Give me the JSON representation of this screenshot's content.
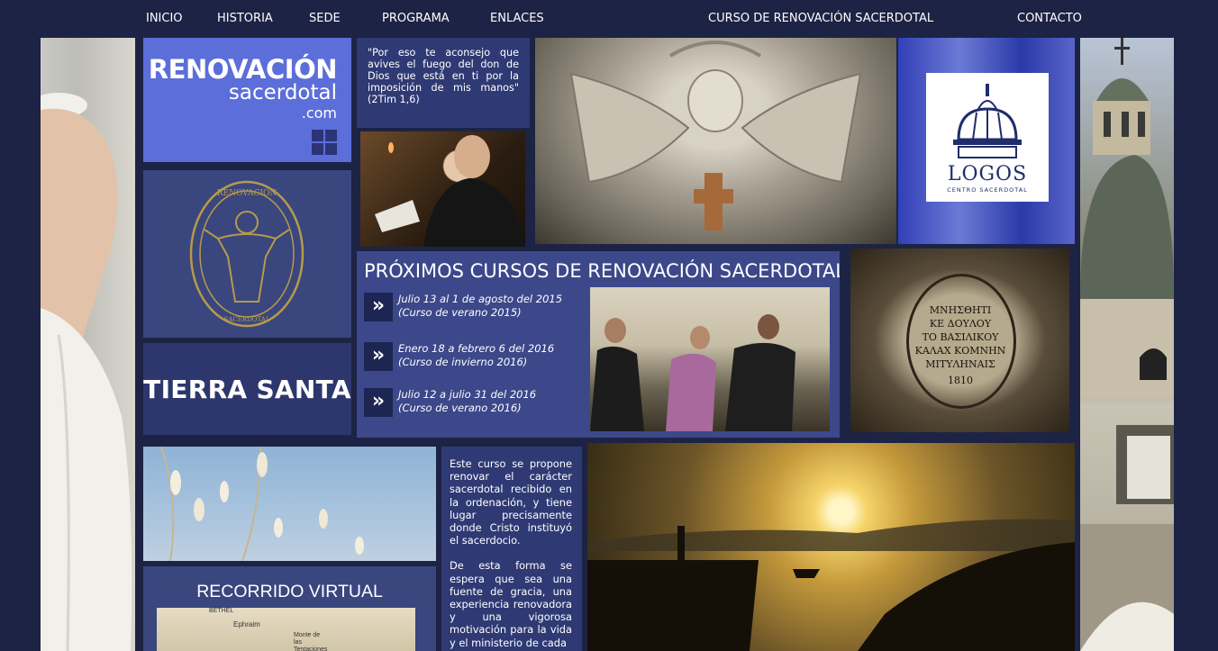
{
  "nav": {
    "items": [
      "INICIO",
      "HISTORIA",
      "SEDE",
      "PROGRAMA",
      "ENLACES",
      "CURSO DE RENOVACIÓN SACERDOTAL",
      "CONTACTO"
    ]
  },
  "brand": {
    "line1": "RENOVACIÓN",
    "line2": "sacerdotal",
    "line3": ".com"
  },
  "seal": {
    "top_text": "RENOVACIÓN",
    "bottom_text": "SACERDOTAL"
  },
  "tierra_santa": "TIERRA SANTA",
  "quote": "\"Por eso te aconsejo que avives el fuego del don de Dios que está en ti por la imposición de mis manos\" (2Tim 1,6)",
  "logos": {
    "name": "LOGOS",
    "subtitle": "CENTRO SACERDOTAL"
  },
  "courses": {
    "title": "PRÓXIMOS CURSOS DE RENOVACIÓN SACERDOTAL:",
    "arrow_glyph": "»",
    "items": [
      {
        "date": "Julio 13 al 1 de  agosto del 2015",
        "note": "(Curso de verano 2015)"
      },
      {
        "date": "Enero 18 a febrero 6 del 2016",
        "note": "(Curso de invierno 2016)"
      },
      {
        "date": "Julio 12 a julio 31 del 2016",
        "note": "(Curso de verano 2016)"
      }
    ]
  },
  "stone_inscription": [
    "ΜΝΗΣΘΗΤΙ",
    "ΚΕ ΔΟΥΛΟΥ",
    "ΤΟ ΒΑΣΙΛΙΚΟΥ",
    "ΚΑΛΑΧ ΚΟΜΝΗΝ",
    "ΜΙΤΥΛΗΝΑΙΣ",
    "1810"
  ],
  "description": {
    "p1": "Este curso se propone renovar el carácter sacerdotal recibido en la ordenación, y tiene lugar precisamente donde Cristo instituyó el sacerdocio.",
    "p2": "De esta forma se espera que sea una fuente de gracia, una experiencia renovadora y una vigorosa motivación para la vida y el ministerio de cada"
  },
  "virtual": {
    "title": "RECORRIDO VIRTUAL",
    "map_labels": [
      "BETHEL",
      "Ephraim",
      "Monte de las Tentaciones"
    ]
  },
  "colors": {
    "background": "#1d2344",
    "brand_tile": "#5c6ed9",
    "tile_mid": "#3a467e",
    "tile_dark": "#2f3a74"
  }
}
